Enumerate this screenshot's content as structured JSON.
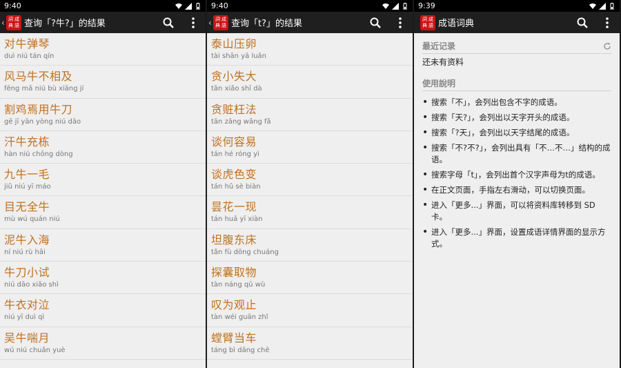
{
  "colors": {
    "accent": "#c0701e",
    "logo": "#c81414",
    "appbar": "#1f1f1f"
  },
  "logo_chars": [
    "詞",
    "成",
    "典",
    "語"
  ],
  "screens": [
    {
      "time": "9:40",
      "title": "查询「?牛?」的结果",
      "rows": [
        {
          "word": "对牛弹琴",
          "pinyin": "duì niú tán qín"
        },
        {
          "word": "风马牛不相及",
          "pinyin": "fēng mǎ niú bù xiāng jí"
        },
        {
          "word": "割鸡焉用牛刀",
          "pinyin": "gē jī yān yòng niú dāo"
        },
        {
          "word": "汗牛充栋",
          "pinyin": "hàn niú chōng dòng"
        },
        {
          "word": "九牛一毛",
          "pinyin": "jiǔ niú yī máo"
        },
        {
          "word": "目无全牛",
          "pinyin": "mù wú quán niú"
        },
        {
          "word": "泥牛入海",
          "pinyin": "ní niú rù hǎi"
        },
        {
          "word": "牛刀小试",
          "pinyin": "niú dāo xiǎo shì"
        },
        {
          "word": "牛衣对泣",
          "pinyin": "niú yī duì qì"
        },
        {
          "word": "吴牛喘月",
          "pinyin": "wú niú chuǎn yuè"
        }
      ]
    },
    {
      "time": "9:40",
      "title": "查询「t?」的结果",
      "rows": [
        {
          "word": "泰山压卵",
          "pinyin": "tài shān yā luǎn"
        },
        {
          "word": "贪小失大",
          "pinyin": "tān xiǎo shī dà"
        },
        {
          "word": "贪赃枉法",
          "pinyin": "tān zāng wǎng fǎ"
        },
        {
          "word": "谈何容易",
          "pinyin": "tán hé róng yì"
        },
        {
          "word": "谈虎色变",
          "pinyin": "tán hǔ sè biàn"
        },
        {
          "word": "昙花一现",
          "pinyin": "tán huā yī xiàn"
        },
        {
          "word": "坦腹东床",
          "pinyin": "tǎn fù dōng chuáng"
        },
        {
          "word": "探囊取物",
          "pinyin": "tàn náng qǔ wù"
        },
        {
          "word": "叹为观止",
          "pinyin": "tàn wéi guān zhǐ"
        },
        {
          "word": "螳臂当车",
          "pinyin": "táng bì dāng chē"
        }
      ]
    },
    {
      "time": "9:39",
      "title": "成语词典",
      "recent_header": "最近记录",
      "recent_empty": "还未有资料",
      "usage_header": "使用說明",
      "usage": [
        "搜索「不」，会列出包含不字的成语。",
        "搜索「天?」，会列出以天字开头的成语。",
        "搜索「?天」，会列出以天字结尾的成语。",
        "搜索「不?不?」，会列出具有「不…不…」结构的成语。",
        "搜索字母「t」，会列出首个汉字声母为t的成语。",
        "在正文页面，手指左右滑动，可以切换页面。",
        "进入「更多...」界面，可以将资料库转移到 SD 卡。",
        "进入「更多...」界面，设置成语详情界面的显示方式。"
      ]
    }
  ]
}
